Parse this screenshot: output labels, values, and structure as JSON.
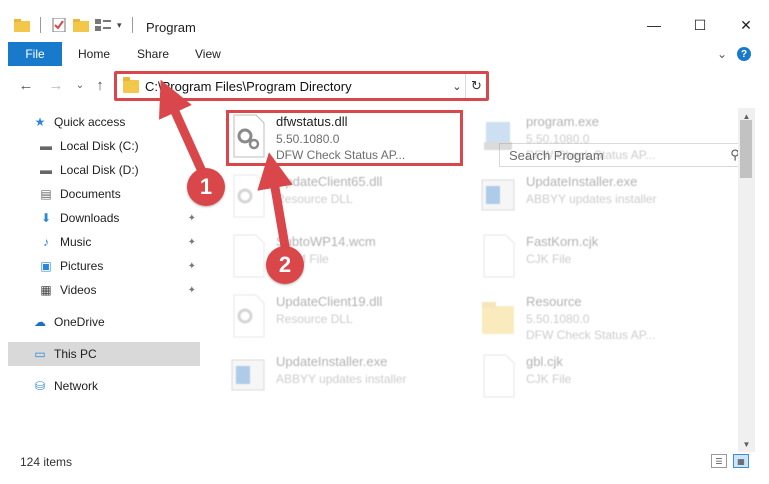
{
  "window": {
    "title": "Program",
    "controls": {
      "minimize": "—",
      "maximize": "☐",
      "close": "✕"
    }
  },
  "ribbon": {
    "file_label": "File",
    "tabs": [
      "Home",
      "Share",
      "View"
    ],
    "expand_glyph": "⌄",
    "help_glyph": "?"
  },
  "nav": {
    "back": "←",
    "forward": "→",
    "recent": "⌄",
    "up": "↑"
  },
  "address": {
    "path": "C:\\Program Files\\Program Directory",
    "dropdown": "⌄",
    "refresh": "↻"
  },
  "search": {
    "placeholder": "Search Program",
    "icon_glyph": "⚲"
  },
  "sidebar": {
    "items": [
      {
        "label": "Quick access",
        "icon": "star-icon",
        "glyph": "★"
      },
      {
        "label": "Local Disk (C:)",
        "icon": "drive-icon",
        "glyph": "▬"
      },
      {
        "label": "Local Disk (D:)",
        "icon": "drive-icon",
        "glyph": "▬"
      },
      {
        "label": "Documents",
        "icon": "documents-icon",
        "glyph": "▤"
      },
      {
        "label": "Downloads",
        "icon": "downloads-icon",
        "glyph": "⬇"
      },
      {
        "label": "Music",
        "icon": "music-icon",
        "glyph": "♪"
      },
      {
        "label": "Pictures",
        "icon": "pictures-icon",
        "glyph": "▣"
      },
      {
        "label": "Videos",
        "icon": "videos-icon",
        "glyph": "▦"
      },
      {
        "label": "OneDrive",
        "icon": "onedrive-icon",
        "glyph": "☁"
      },
      {
        "label": "This PC",
        "icon": "computer-icon",
        "glyph": "▭"
      },
      {
        "label": "Network",
        "icon": "network-icon",
        "glyph": "⛁"
      }
    ],
    "pin_glyph": "📌",
    "selected": "This PC"
  },
  "files": [
    {
      "name": "dfwstatus.dll",
      "line1": "5.50.1080.0",
      "line2": "DFW Check Status AP...",
      "type": "dll"
    },
    {
      "name": "program.exe",
      "line1": "5.50.1080.0",
      "line2": "DFW Check Status AP...",
      "type": "exe"
    },
    {
      "name": "UpdateClient65.dll",
      "line1": "Resource DLL",
      "line2": "",
      "type": "dll"
    },
    {
      "name": "UpdateInstaller.exe",
      "line1": "ABBYY updates installer",
      "line2": "",
      "type": "installer"
    },
    {
      "name": "SubtoWP14.wcm",
      "line1": "WCM File",
      "line2": "",
      "type": "blank"
    },
    {
      "name": "FastKorn.cjk",
      "line1": "CJK File",
      "line2": "",
      "type": "blank"
    },
    {
      "name": "UpdateClient19.dll",
      "line1": "Resource DLL",
      "line2": "",
      "type": "dll"
    },
    {
      "name": "Resource",
      "line1": "5.50.1080.0",
      "line2": "DFW Check Status AP...",
      "type": "folder"
    },
    {
      "name": "UpdateInstaller.exe",
      "line1": "ABBYY updates installer",
      "line2": "",
      "type": "installer"
    },
    {
      "name": "gbl.cjk",
      "line1": "CJK File",
      "line2": "",
      "type": "blank"
    }
  ],
  "status": {
    "count": "124 items"
  },
  "callouts": {
    "one": "1",
    "two": "2"
  },
  "colors": {
    "accent": "#1979ca",
    "highlight": "#d9474a",
    "selected_bg": "#d9d9d9"
  }
}
